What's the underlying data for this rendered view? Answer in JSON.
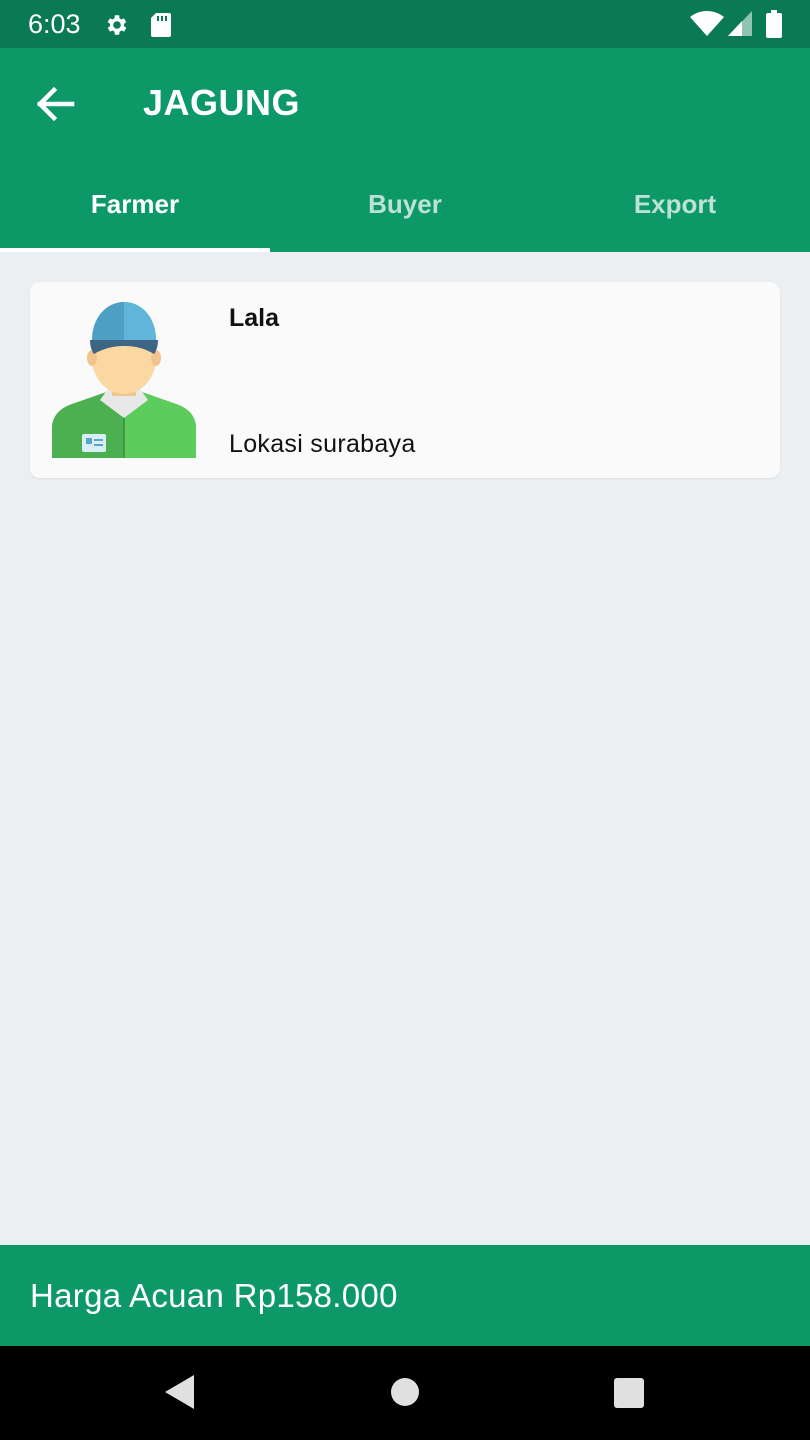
{
  "status_bar": {
    "time": "6:03",
    "icons": [
      "gear-icon",
      "sd-card-icon",
      "wifi-icon",
      "signal-icon",
      "battery-icon"
    ]
  },
  "app_bar": {
    "title": "JAGUNG",
    "back_icon": "arrow-left-icon"
  },
  "tabs": [
    {
      "label": "Farmer",
      "active": true
    },
    {
      "label": "Buyer",
      "active": false
    },
    {
      "label": "Export",
      "active": false
    }
  ],
  "list": {
    "items": [
      {
        "name": "Lala",
        "location": "Lokasi surabaya",
        "avatar": "farmer-avatar"
      }
    ]
  },
  "footer": {
    "price_text": "Harga Acuan Rp158.000"
  },
  "nav": {
    "icons": [
      "back-triangle-icon",
      "home-circle-icon",
      "recents-square-icon"
    ]
  },
  "colors": {
    "primary": "#0d9868",
    "status_bar": "#0a7a55",
    "background": "#eceff1",
    "card": "#fafafa"
  }
}
